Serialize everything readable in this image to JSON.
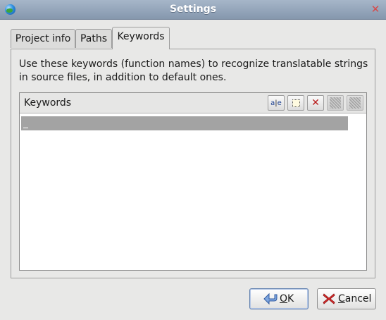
{
  "window": {
    "title": "Settings"
  },
  "tabs": [
    {
      "label": "Project info"
    },
    {
      "label": "Paths"
    },
    {
      "label": "Keywords",
      "active": true
    }
  ],
  "keywords_tab": {
    "description": "Use these keywords (function names) to recognize translatable strings in source files, in addition to default ones.",
    "list_header": "Keywords",
    "toolbar": [
      {
        "icon": "rename-icon",
        "glyph": "a|e",
        "enabled": true
      },
      {
        "icon": "new-item-icon",
        "enabled": true
      },
      {
        "icon": "delete-icon",
        "glyph": "✕",
        "enabled": true
      },
      {
        "icon": "move-up-icon",
        "enabled": false
      },
      {
        "icon": "move-down-icon",
        "enabled": false
      }
    ],
    "items": [
      {
        "text": "_",
        "selected": true
      }
    ]
  },
  "buttons": {
    "ok": {
      "label_mnemonic": "O",
      "label_rest": "K"
    },
    "cancel": {
      "label_mnemonic": "C",
      "label_rest": "ancel"
    }
  },
  "colors": {
    "titlebar": "#93a4b9",
    "selection": "#a3a3a3",
    "delete_icon": "#b81c1c"
  }
}
